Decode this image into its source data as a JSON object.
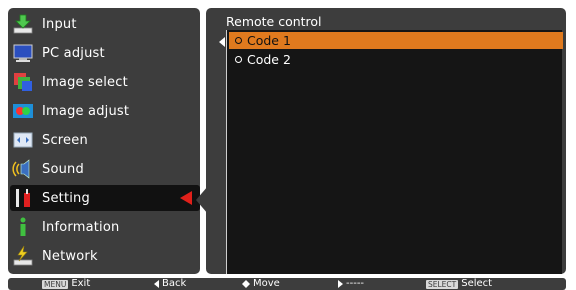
{
  "menu": {
    "items": [
      {
        "label": "Input",
        "icon": "input-icon"
      },
      {
        "label": "PC adjust",
        "icon": "pc-adjust-icon"
      },
      {
        "label": "Image select",
        "icon": "image-select-icon"
      },
      {
        "label": "Image adjust",
        "icon": "image-adjust-icon"
      },
      {
        "label": "Screen",
        "icon": "screen-icon"
      },
      {
        "label": "Sound",
        "icon": "sound-icon"
      },
      {
        "label": "Setting",
        "icon": "setting-icon"
      },
      {
        "label": "Information",
        "icon": "information-icon"
      },
      {
        "label": "Network",
        "icon": "network-icon"
      }
    ],
    "selected": "Setting",
    "selected_color": "#e0201a"
  },
  "panel": {
    "title": "Remote control",
    "options": [
      {
        "label": "Code 1",
        "active": true
      },
      {
        "label": "Code 2",
        "active": false
      }
    ],
    "highlight_color": "#e07a1e"
  },
  "footer": {
    "exit_key": "MENU",
    "exit": "Exit",
    "back": "Back",
    "move": "Move",
    "next": "-----",
    "select_key": "SELECT",
    "select": "Select"
  }
}
